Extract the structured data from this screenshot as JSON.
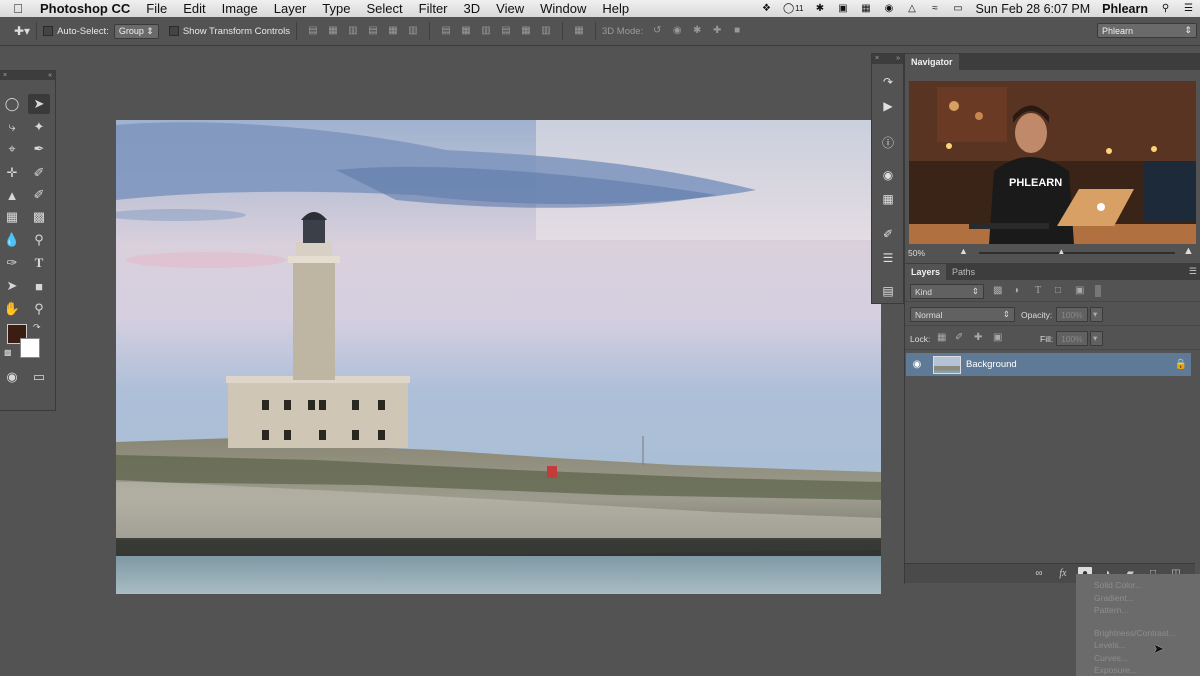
{
  "menubar": {
    "app_name": "Photoshop CC",
    "items": [
      "File",
      "Edit",
      "Image",
      "Layer",
      "Type",
      "Select",
      "Filter",
      "3D",
      "View",
      "Window",
      "Help"
    ],
    "status_badge": "11",
    "datetime": "Sun Feb 28  6:07 PM",
    "user": "Phlearn"
  },
  "options_bar": {
    "auto_select_label": "Auto-Select:",
    "auto_select_value": "Group",
    "show_transform_label": "Show Transform Controls",
    "mode_3d_label": "3D Mode:",
    "workspace": "Phlearn"
  },
  "colors": {
    "foreground": "#3b1d12",
    "background": "#ffffff",
    "selection": "#5f7a96",
    "panel": "#535353"
  },
  "navigator": {
    "tab": "Navigator",
    "zoom": "50%",
    "zoom_slider_fraction": 0.42,
    "shirt_text": "PHLEARN"
  },
  "layers_panel": {
    "tabs": [
      "Layers",
      "Paths"
    ],
    "filter_kind": "Kind",
    "blend_mode": "Normal",
    "opacity_label": "Opacity:",
    "opacity_value": "100%",
    "lock_label": "Lock:",
    "fill_label": "Fill:",
    "fill_value": "100%",
    "layers": [
      {
        "name": "Background",
        "visible": true,
        "locked": true
      }
    ]
  },
  "adjustment_menu": {
    "items": [
      "Solid Color...",
      "Gradient...",
      "Pattern...",
      "Brightness/Contrast...",
      "Levels...",
      "Curves...",
      "Exposure..."
    ]
  }
}
